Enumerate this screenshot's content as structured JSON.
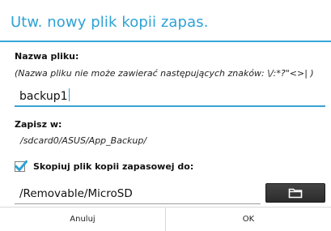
{
  "dialog": {
    "title": "Utw. nowy plik kopii zapas."
  },
  "filename": {
    "label": "Nazwa pliku:",
    "hint": "(Nazwa pliku nie może zawierać następujących znaków: \\/:*?\"<>| )",
    "value": "backup1"
  },
  "save_to": {
    "label": "Zapisz w:",
    "path": "/sdcard0/ASUS/App_Backup/"
  },
  "copy_to": {
    "checked": true,
    "label": "Skopiuj plik kopii zapasowej do:",
    "value": "/Removable/MicroSD",
    "button_icon": "folder-icon"
  },
  "buttons": {
    "cancel": "Anuluj",
    "ok": "OK"
  },
  "colors": {
    "accent": "#2ea2d6",
    "button_dark": "#333333"
  }
}
